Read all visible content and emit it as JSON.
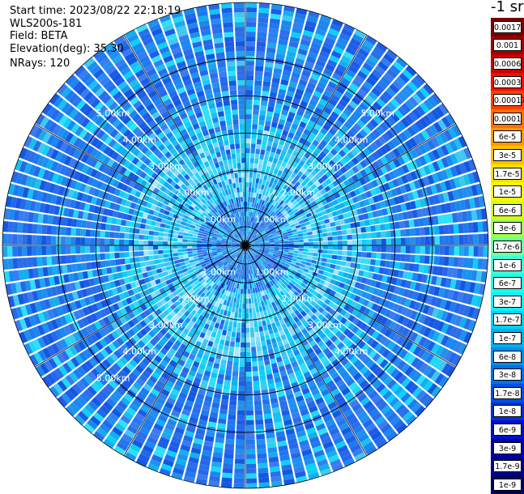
{
  "info": {
    "start_time": "Start time: 2023/08/22 22:18:19",
    "instrument": "WLS200s-181",
    "field": "Field: BETA",
    "elevation": "Elevation(deg): 35.30",
    "nrays": "NRays: 120"
  },
  "colorbar": {
    "unit": "-1 sr",
    "labels": [
      "0.0017",
      "0.001",
      "0.0006",
      "0.0003",
      "0.00017",
      "0.0001",
      "6e-5",
      "3e-5",
      "1.7e-5",
      "1e-5",
      "6e-6",
      "3e-6",
      "1.7e-6",
      "1e-6",
      "6e-7",
      "3e-7",
      "1.7e-7",
      "1e-7",
      "6e-8",
      "3e-8",
      "1.7e-8",
      "1e-8",
      "6e-9",
      "3e-9",
      "1.7e-9",
      "1e-9"
    ],
    "colors": [
      "#7a0000",
      "#a00000",
      "#c80000",
      "#f01000",
      "#ff4000",
      "#ff7000",
      "#ff9800",
      "#ffc000",
      "#ffe000",
      "#f8f800",
      "#d0ff20",
      "#a0ff50",
      "#70ffa0",
      "#40ffd0",
      "#20ffe8",
      "#10f0f8",
      "#00d0f8",
      "#00b0f0",
      "#0090ec",
      "#0070e8",
      "#0050e0",
      "#0030d8",
      "#0010c8",
      "#0000b0",
      "#000090",
      "#000060"
    ]
  },
  "range_labels": [
    "1.00km",
    "2.00km",
    "3.00km",
    "4.00km",
    "5.00km"
  ],
  "chart_data": {
    "type": "heatmap",
    "projection": "polar PPI",
    "field": "BETA",
    "elevation_deg": 35.3,
    "n_rays": 120,
    "range_rings_km": [
      1,
      2,
      3,
      4,
      5
    ],
    "max_range_km": 5.0,
    "scale": "log",
    "value_range": [
      1e-09,
      0.0017
    ],
    "typical_values": {
      "near_range_0_1km": 1e-08,
      "mid_range_1_2_5km": 1.7e-07,
      "far_range_2_5_5km": 3e-08
    }
  }
}
